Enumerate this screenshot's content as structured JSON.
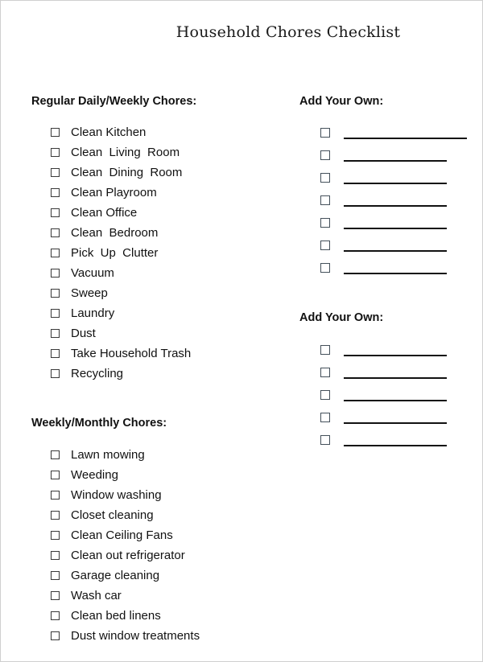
{
  "document": {
    "title": "Household Chores Checklist"
  },
  "regular": {
    "heading": "Regular Daily/Weekly Chores:",
    "items": [
      "Clean Kitchen",
      "Clean  Living  Room",
      "Clean  Dining  Room",
      "Clean Playroom",
      "Clean Office",
      "Clean  Bedroom",
      "Pick  Up  Clutter",
      "Vacuum",
      "Sweep",
      "Laundry",
      "Dust",
      "Take Household Trash",
      "Recycling"
    ]
  },
  "monthly": {
    "heading": "Weekly/Monthly Chores:",
    "items": [
      "Lawn mowing",
      "Weeding",
      "Window washing",
      "Closet cleaning",
      "Clean Ceiling Fans",
      "Clean out refrigerator",
      "Garage cleaning",
      "Wash car",
      "Clean bed linens",
      "Dust window treatments"
    ]
  },
  "custom1": {
    "heading": "Add Your Own:",
    "blank_count": 7
  },
  "custom2": {
    "heading": "Add Your Own:",
    "blank_count": 5
  }
}
